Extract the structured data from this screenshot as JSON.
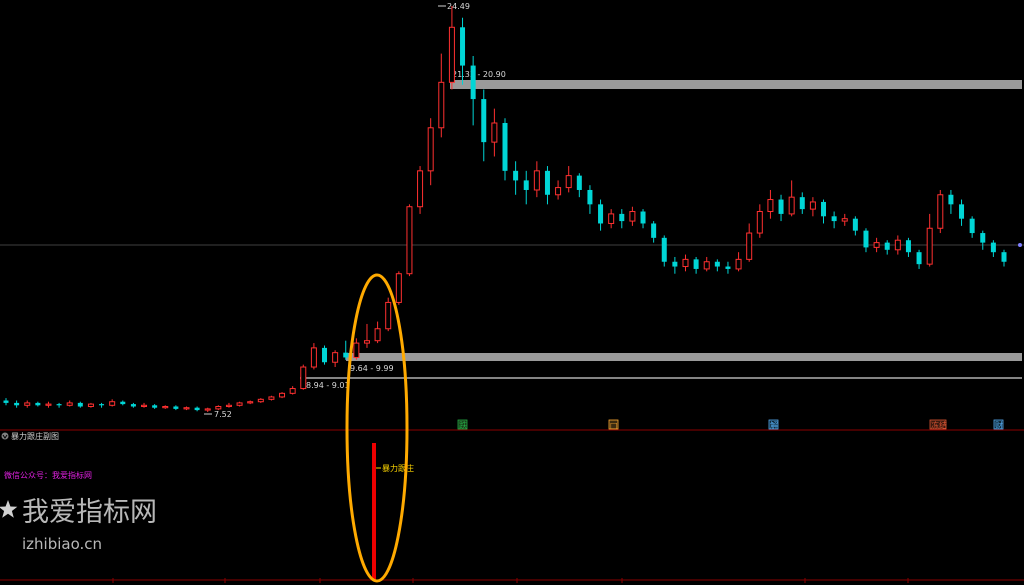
{
  "price_panel": {
    "high_label": "24.49",
    "low_label": "7.52",
    "zones": [
      {
        "label": "21.33 - 20.90",
        "low": 20.9,
        "high": 21.33
      },
      {
        "label": "9.64 - 9.99",
        "low": 9.64,
        "high": 9.99
      },
      {
        "label": "8.94 - 9.01",
        "low": 8.94,
        "high": 9.01
      }
    ]
  },
  "sub_panel": {
    "title": "暴力跟庄副图",
    "promo_text": "微信公众号：我爱指标网",
    "signal_label": "暴力跟庄"
  },
  "event_badges": [
    {
      "text": "跌",
      "color": "#22aa44"
    },
    {
      "text": "□",
      "color": "#ffaa33"
    },
    {
      "text": "解",
      "color": "#55aaee"
    },
    {
      "text": "冻结",
      "color": "#dd5533"
    },
    {
      "text": "财",
      "color": "#55aaee"
    }
  ],
  "watermark": {
    "title": "我爱指标网",
    "url": "izhibiao.cn"
  },
  "colors": {
    "up": "#ff3030",
    "down": "#00d6d6",
    "zone": "#9a9a9a",
    "highlight_ellipse": "#ffaa00"
  },
  "chart_data": {
    "type": "candlestick",
    "high": 24.49,
    "low": 7.52,
    "candles": [
      [
        8.0,
        7.9,
        8.1,
        7.8
      ],
      [
        7.9,
        7.8,
        8.0,
        7.7
      ],
      [
        7.8,
        7.9,
        8.0,
        7.7
      ],
      [
        7.9,
        7.8,
        7.95,
        7.75
      ],
      [
        7.8,
        7.85,
        7.95,
        7.7
      ],
      [
        7.85,
        7.8,
        7.9,
        7.7
      ],
      [
        7.8,
        7.9,
        8.0,
        7.75
      ],
      [
        7.9,
        7.75,
        7.95,
        7.7
      ],
      [
        7.75,
        7.85,
        7.9,
        7.7
      ],
      [
        7.85,
        7.8,
        7.9,
        7.7
      ],
      [
        7.8,
        7.95,
        8.05,
        7.75
      ],
      [
        7.95,
        7.85,
        8.0,
        7.8
      ],
      [
        7.85,
        7.75,
        7.9,
        7.7
      ],
      [
        7.75,
        7.8,
        7.9,
        7.7
      ],
      [
        7.8,
        7.7,
        7.85,
        7.65
      ],
      [
        7.7,
        7.75,
        7.8,
        7.65
      ],
      [
        7.75,
        7.65,
        7.8,
        7.6
      ],
      [
        7.65,
        7.7,
        7.75,
        7.6
      ],
      [
        7.7,
        7.6,
        7.75,
        7.55
      ],
      [
        7.6,
        7.65,
        7.7,
        7.52
      ],
      [
        7.65,
        7.75,
        7.8,
        7.6
      ],
      [
        7.75,
        7.8,
        7.9,
        7.7
      ],
      [
        7.8,
        7.9,
        7.95,
        7.75
      ],
      [
        7.9,
        7.95,
        8.0,
        7.85
      ],
      [
        7.95,
        8.05,
        8.1,
        7.9
      ],
      [
        8.05,
        8.15,
        8.2,
        8.0
      ],
      [
        8.15,
        8.3,
        8.35,
        8.1
      ],
      [
        8.3,
        8.5,
        8.6,
        8.25
      ],
      [
        8.5,
        9.4,
        9.5,
        8.45
      ],
      [
        9.4,
        10.2,
        10.4,
        9.3
      ],
      [
        10.2,
        9.6,
        10.3,
        9.5
      ],
      [
        9.6,
        10.0,
        10.1,
        9.4
      ],
      [
        10.0,
        9.8,
        10.5,
        9.7
      ],
      [
        9.8,
        10.4,
        10.6,
        9.7
      ],
      [
        10.4,
        10.5,
        11.2,
        10.2
      ],
      [
        10.5,
        11.0,
        11.3,
        10.4
      ],
      [
        11.0,
        12.1,
        12.3,
        10.9
      ],
      [
        12.1,
        13.3,
        13.4,
        12.0
      ],
      [
        13.3,
        16.1,
        16.2,
        13.2
      ],
      [
        16.1,
        17.6,
        17.8,
        15.8
      ],
      [
        17.6,
        19.4,
        19.8,
        17.0
      ],
      [
        19.4,
        21.3,
        22.5,
        19.0
      ],
      [
        21.3,
        23.6,
        24.49,
        21.0
      ],
      [
        23.6,
        22.0,
        24.0,
        21.2
      ],
      [
        22.0,
        20.6,
        22.4,
        19.5
      ],
      [
        20.6,
        18.8,
        21.0,
        18.0
      ],
      [
        18.8,
        19.6,
        20.2,
        18.2
      ],
      [
        19.6,
        17.6,
        19.8,
        17.2
      ],
      [
        17.6,
        17.2,
        18.0,
        16.6
      ],
      [
        17.2,
        16.8,
        17.6,
        16.2
      ],
      [
        16.8,
        17.6,
        18.0,
        16.5
      ],
      [
        17.6,
        16.6,
        17.8,
        16.2
      ],
      [
        16.6,
        16.9,
        17.2,
        16.4
      ],
      [
        16.9,
        17.4,
        17.8,
        16.7
      ],
      [
        17.4,
        16.8,
        17.5,
        16.5
      ],
      [
        16.8,
        16.2,
        17.0,
        15.8
      ],
      [
        16.2,
        15.4,
        16.4,
        15.1
      ],
      [
        15.4,
        15.8,
        16.0,
        15.2
      ],
      [
        15.8,
        15.5,
        16.0,
        15.2
      ],
      [
        15.5,
        15.9,
        16.1,
        15.3
      ],
      [
        15.9,
        15.4,
        16.0,
        15.2
      ],
      [
        15.4,
        14.8,
        15.5,
        14.6
      ],
      [
        14.8,
        13.8,
        14.9,
        13.6
      ],
      [
        13.8,
        13.6,
        14.0,
        13.3
      ],
      [
        13.6,
        13.9,
        14.1,
        13.4
      ],
      [
        13.9,
        13.5,
        14.0,
        13.3
      ],
      [
        13.5,
        13.8,
        14.0,
        13.4
      ],
      [
        13.8,
        13.6,
        13.9,
        13.4
      ],
      [
        13.6,
        13.5,
        13.8,
        13.3
      ],
      [
        13.5,
        13.9,
        14.2,
        13.4
      ],
      [
        13.9,
        15.0,
        15.4,
        13.8
      ],
      [
        15.0,
        15.9,
        16.2,
        14.8
      ],
      [
        15.9,
        16.4,
        16.8,
        15.6
      ],
      [
        16.4,
        15.8,
        16.6,
        15.5
      ],
      [
        15.8,
        16.5,
        17.2,
        15.7
      ],
      [
        16.5,
        16.0,
        16.7,
        15.8
      ],
      [
        16.0,
        16.3,
        16.5,
        15.7
      ],
      [
        16.3,
        15.7,
        16.4,
        15.4
      ],
      [
        15.7,
        15.5,
        15.9,
        15.2
      ],
      [
        15.5,
        15.6,
        15.8,
        15.3
      ],
      [
        15.6,
        15.1,
        15.7,
        14.9
      ],
      [
        15.1,
        14.4,
        15.2,
        14.2
      ],
      [
        14.4,
        14.6,
        14.8,
        14.2
      ],
      [
        14.6,
        14.3,
        14.7,
        14.1
      ],
      [
        14.3,
        14.7,
        14.9,
        14.1
      ],
      [
        14.7,
        14.2,
        14.8,
        14.0
      ],
      [
        14.2,
        13.7,
        14.3,
        13.5
      ],
      [
        13.7,
        15.2,
        15.8,
        13.6
      ],
      [
        15.2,
        16.6,
        16.8,
        15.0
      ],
      [
        16.6,
        16.2,
        16.8,
        15.8
      ],
      [
        16.2,
        15.6,
        16.4,
        15.3
      ],
      [
        15.6,
        15.0,
        15.7,
        14.8
      ],
      [
        15.0,
        14.6,
        15.1,
        14.3
      ],
      [
        14.6,
        14.2,
        14.7,
        14.0
      ],
      [
        14.2,
        13.8,
        14.3,
        13.6
      ]
    ]
  }
}
